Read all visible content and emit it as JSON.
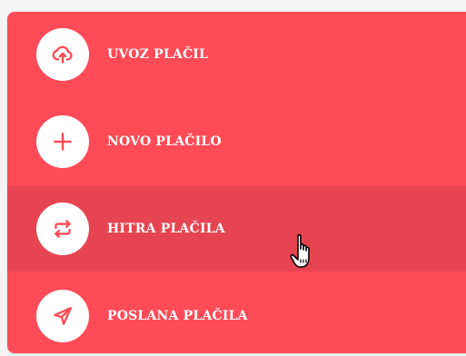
{
  "colors": {
    "panel": "#ff4b57",
    "hover": "#e74451",
    "icon_bg": "#ffffff",
    "icon_fg": "#ff4b57",
    "label": "#ffffff"
  },
  "menu": {
    "items": [
      {
        "label": "UVOZ PLAČIL",
        "icon": "cloud-upload-icon"
      },
      {
        "label": "NOVO PLAČILO",
        "icon": "plus-icon"
      },
      {
        "label": "HITRA PLAČILA",
        "icon": "repeat-arrows-icon",
        "hovered": true
      },
      {
        "label": "POSLANA PLAČILA",
        "icon": "send-icon"
      }
    ]
  },
  "cursor": {
    "icon": "hand-pointer-cursor-icon"
  }
}
